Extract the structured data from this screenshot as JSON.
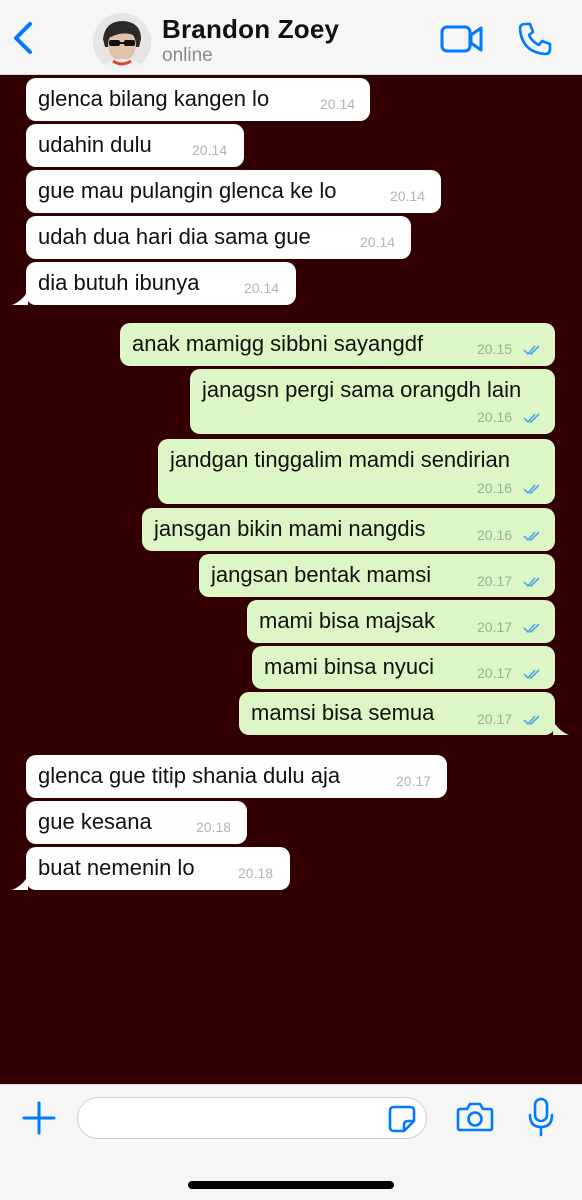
{
  "header": {
    "contact_name": "Brandon Zoey",
    "status": "online",
    "icons": [
      "back-chevron-icon",
      "video-call-icon",
      "phone-icon"
    ],
    "accent_color": "#007aff"
  },
  "chat": {
    "background_color": "#320000",
    "incoming_color": "#ffffff",
    "outgoing_color": "#dcf7c5",
    "read_tick_color": "#4aa6e8",
    "messages": [
      {
        "direction": "in",
        "text": "glenca bilang kangen lo",
        "time": "20.14"
      },
      {
        "direction": "in",
        "text": "udahin dulu",
        "time": "20.14"
      },
      {
        "direction": "in",
        "text": "gue mau pulangin glenca ke lo",
        "time": "20.14"
      },
      {
        "direction": "in",
        "text": "udah dua hari dia sama gue",
        "time": "20.14"
      },
      {
        "direction": "in",
        "text": "dia butuh ibunya",
        "time": "20.14"
      },
      {
        "direction": "out",
        "text": "anak mamigg sibbni sayangdf",
        "time": "20.15",
        "read": true
      },
      {
        "direction": "out",
        "text": "janagsn pergi sama orangdh lain",
        "time": "20.16",
        "read": true
      },
      {
        "direction": "out",
        "text": "jandgan tinggalim mamdi sendirian",
        "time": "20.16",
        "read": true
      },
      {
        "direction": "out",
        "text": "jansgan bikin mami nangdis",
        "time": "20.16",
        "read": true
      },
      {
        "direction": "out",
        "text": "jangsan bentak mamsi",
        "time": "20.17",
        "read": true
      },
      {
        "direction": "out",
        "text": "mami bisa majsak",
        "time": "20.17",
        "read": true
      },
      {
        "direction": "out",
        "text": "mami binsa nyuci",
        "time": "20.17",
        "read": true
      },
      {
        "direction": "out",
        "text": "mamsi bisa semua",
        "time": "20.17",
        "read": true
      },
      {
        "direction": "in",
        "text": "glenca gue titip shania dulu aja",
        "time": "20.17"
      },
      {
        "direction": "in",
        "text": "gue kesana",
        "time": "20.18"
      },
      {
        "direction": "in",
        "text": "buat nemenin lo",
        "time": "20.18"
      }
    ]
  },
  "input_bar": {
    "message_value": "",
    "icons": [
      "plus-icon",
      "sticker-icon",
      "camera-icon",
      "microphone-icon"
    ]
  }
}
